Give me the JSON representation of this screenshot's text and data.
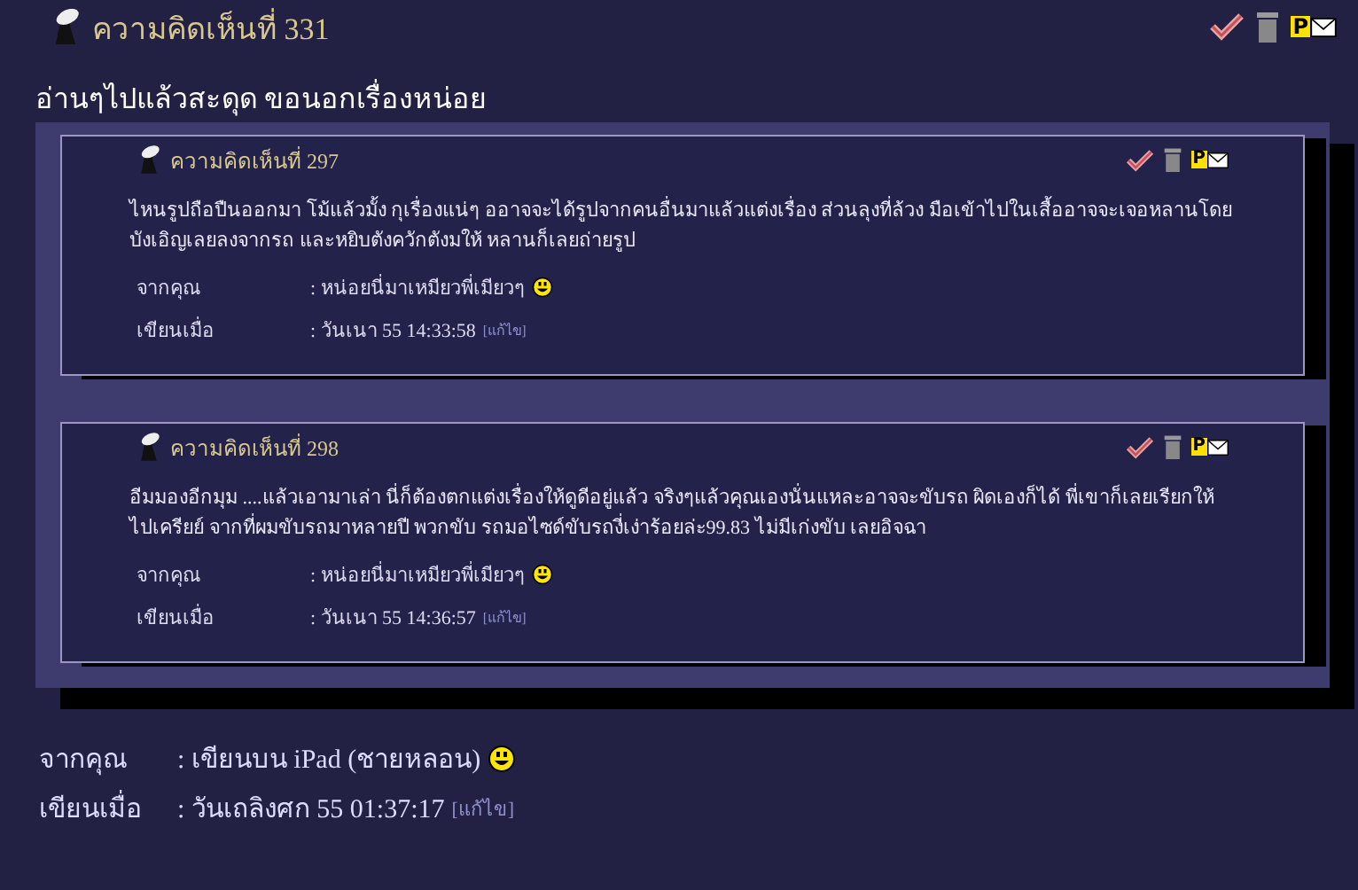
{
  "comment": {
    "number_label": "ความคิดเห็นที่ 331",
    "pm_letter": "P",
    "title": "อ่านๆไปแล้วสะดุด ขอนอกเรื่องหน่อย",
    "quotes": [
      {
        "number_label": "ความคิดเห็นที่ 297",
        "pm_letter": "P",
        "body": "ไหนรูปถือปืนออกมา โม้แล้วมั้ง กุเรื่องแน่ๆ ออาจจะได้รูปจากคนอื่นมาแล้วแต่งเรื่อง ส่วนลุงที่ล้วง มือเข้าไปในเสื้ออาจจะเจอหลานโดยบังเอิญเลยลงจากรถ และหยิบตังควักตังมให้ หลานก็เลยถ่ายรูป",
        "from_label": "จากคุณ",
        "from_value": ": หน่อยนี่มาเหมียวพี่เมียวๆ",
        "written_label": "เขียนเมื่อ",
        "written_value": ": วันเนา 55 14:33:58",
        "edit_link": "[แก้ไข]"
      },
      {
        "number_label": "ความคิดเห็นที่ 298",
        "pm_letter": "P",
        "body": "อีมมองอีกมุม ....แล้วเอามาเล่า นี่ก็ต้องตกแต่งเรื่องให้ดูดีอยู่แล้ว จริงๆแล้วคุณเองนั่นแหละอาจจะขับรถ ผิดเองก็ได้ พี่เขาก็เลยเรียกให้ไปเครียย์ จากที่ผมขับรถมาหลายปี พวกขับ รถมอไซด์ขับรถงี่เง่าร้อยล่ะ99.83 ไม่มีเก่งขับ เลยอิจฉา",
        "from_label": "จากคุณ",
        "from_value": ": หน่อยนี่มาเหมียวพี่เมียวๆ",
        "written_label": "เขียนเมื่อ",
        "written_value": ": วันเนา 55 14:36:57",
        "edit_link": "[แก้ไข]"
      }
    ],
    "from_label": "จากคุณ",
    "from_value": ": เขียนบน iPad (ชายหลอน)",
    "written_label": "เขียนเมื่อ",
    "written_value": ": วันเถลิงศก 55 01:37:17",
    "edit_link": "[แก้ไข]"
  }
}
